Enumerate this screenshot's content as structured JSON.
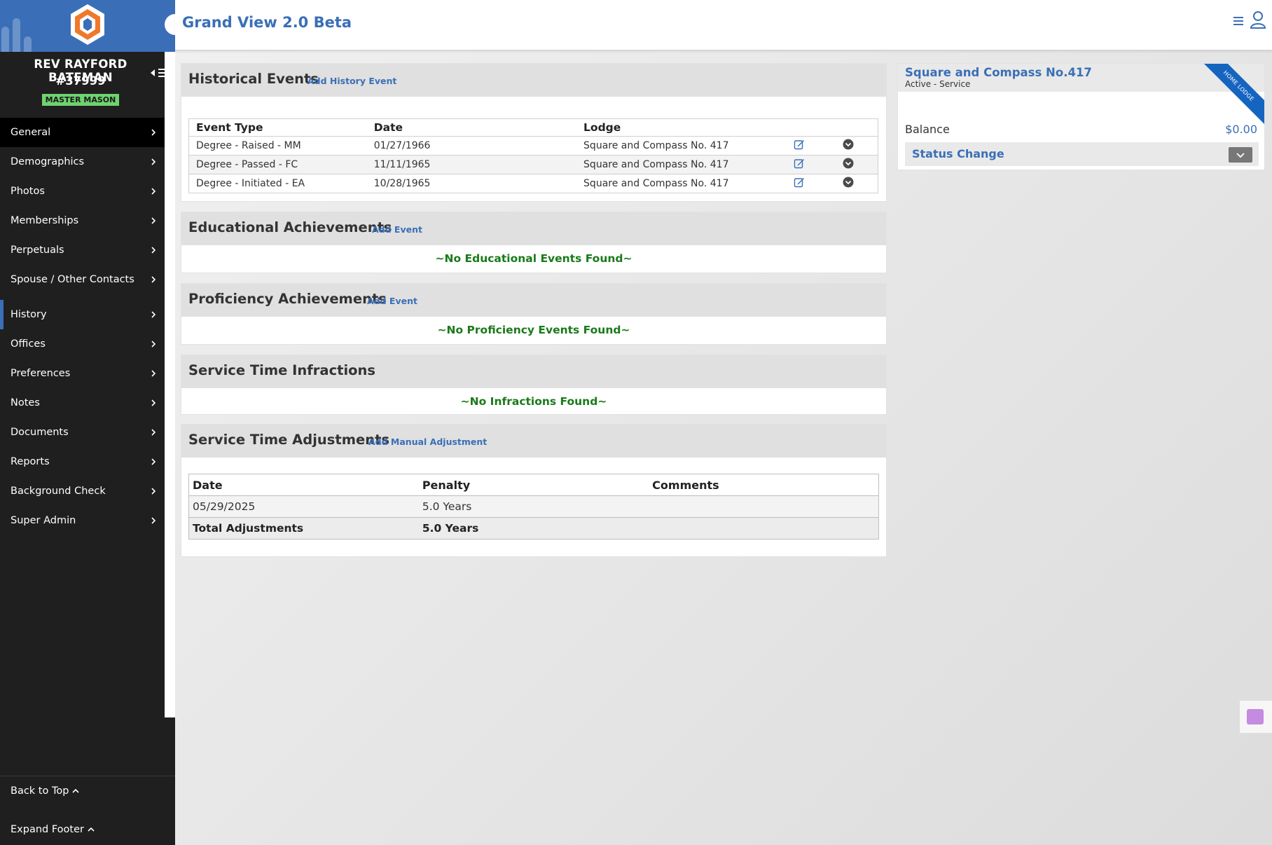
{
  "app": {
    "title": "Grand View 2.0 Beta"
  },
  "member": {
    "name": "REV RAYFORD BATEMAN",
    "id": "#37999",
    "rank": "MASTER MASON"
  },
  "nav": {
    "items": [
      {
        "label": "General"
      },
      {
        "label": "Demographics"
      },
      {
        "label": "Photos"
      },
      {
        "label": "Memberships"
      },
      {
        "label": "Perpetuals"
      },
      {
        "label": "Spouse / Other Contacts"
      },
      {
        "label": "History"
      },
      {
        "label": "Offices"
      },
      {
        "label": "Preferences"
      },
      {
        "label": "Notes"
      },
      {
        "label": "Documents"
      },
      {
        "label": "Reports"
      },
      {
        "label": "Background Check"
      },
      {
        "label": "Super Admin"
      }
    ],
    "active": "General",
    "current": "History"
  },
  "footer": {
    "back_to_top": "Back to Top",
    "expand_footer": "Expand Footer"
  },
  "historical": {
    "title": "Historical Events",
    "action": "Add History Event",
    "headers": {
      "event_type": "Event Type",
      "date": "Date",
      "lodge": "Lodge"
    },
    "rows": [
      {
        "event_type": "Degree - Raised - MM",
        "date": "01/27/1966",
        "lodge": "Square and Compass No. 417"
      },
      {
        "event_type": "Degree - Passed - FC",
        "date": "11/11/1965",
        "lodge": "Square and Compass No. 417"
      },
      {
        "event_type": "Degree - Initiated - EA",
        "date": "10/28/1965",
        "lodge": "Square and Compass No. 417"
      }
    ]
  },
  "educational": {
    "title": "Educational Achievements",
    "action": "Add Event",
    "empty": "~No Educational Events Found~"
  },
  "proficiency": {
    "title": "Proficiency Achievements",
    "action": "Add Event",
    "empty": "~No Proficiency Events Found~"
  },
  "infractions": {
    "title": "Service Time Infractions",
    "empty": "~No Infractions Found~"
  },
  "adjustments": {
    "title": "Service Time Adjustments",
    "action": "Add Manual Adjustment",
    "headers": {
      "date": "Date",
      "penalty": "Penalty",
      "comments": "Comments"
    },
    "rows": [
      {
        "date": "05/29/2025",
        "penalty": "5.0 Years",
        "comments": ""
      }
    ],
    "total": {
      "label": "Total Adjustments",
      "value": "5.0 Years"
    }
  },
  "lodge_card": {
    "name": "Square and Compass No.417",
    "status": "Active  - Service",
    "ribbon": "HOME LODGE",
    "balance_label": "Balance",
    "balance_value": "$0.00",
    "status_change": "Status Change"
  },
  "colors": {
    "accent": "#3a6fb7",
    "sidebar": "#1f1f1f",
    "badge": "#6fd36f",
    "success_text": "#1a7a1a",
    "ribbon": "#1565c0"
  }
}
